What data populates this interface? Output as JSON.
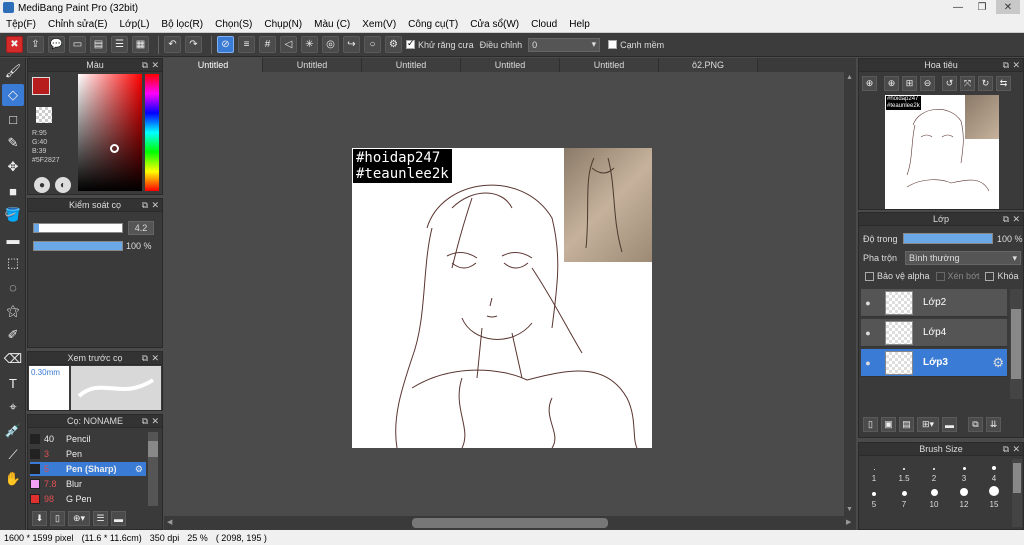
{
  "window": {
    "title": "MediBang Paint Pro (32bit)",
    "min_label": "—",
    "max_label": "❐",
    "close_label": "✕"
  },
  "menu": [
    "Tệp(F)",
    "Chỉnh sửa(E)",
    "Lớp(L)",
    "Bộ lọc(R)",
    "Chọn(S)",
    "Chụp(N)",
    "Màu (C)",
    "Xem(V)",
    "Công cụ(T)",
    "Cửa sổ(W)",
    "Cloud",
    "Help"
  ],
  "toolbar": {
    "antialias_label": "Khử răng cưa",
    "correction_label": "Điều chỉnh",
    "correction_value": "0",
    "snap_label": "Cạnh mềm"
  },
  "tabs": [
    "Untitled",
    "Untitled",
    "Untitled",
    "Untitled",
    "Untitled",
    "ô2.PNG"
  ],
  "color_panel": {
    "title": "Màu",
    "r": "R:95",
    "g": "G:40",
    "b": "B:39",
    "hex": "#5F2827",
    "fg_color": "#b81d1d"
  },
  "brush_ctrl": {
    "title": "Kiểm soát cọ",
    "size": "4.2",
    "opacity": "100 %"
  },
  "preview": {
    "title": "Xem trước cọ",
    "size": "0.30mm"
  },
  "brushes": {
    "title": "Cọ: NONAME",
    "items": [
      {
        "size": "40",
        "name": "Pencil",
        "color": "#222222"
      },
      {
        "size": "3",
        "name": "Pen",
        "color": "#222222"
      },
      {
        "size": "5",
        "name": "Pen (Sharp)",
        "color": "#222222"
      },
      {
        "size": "7.8",
        "name": "Blur",
        "color": "#f2a0f2"
      },
      {
        "size": "98",
        "name": "G Pen",
        "color": "#e03030"
      }
    ]
  },
  "navigator": {
    "title": "Hoa tiêu"
  },
  "layers": {
    "title": "Lớp",
    "opacity_label": "Độ trong",
    "opacity_value": "100 %",
    "blend_label": "Pha trộn",
    "blend_value": "Bình thường",
    "protect_alpha": "Bảo vệ alpha",
    "clipping": "Xén bớt",
    "lock": "Khóa",
    "items": [
      {
        "name": "Lớp2"
      },
      {
        "name": "Lớp4"
      },
      {
        "name": "Lớp3"
      }
    ]
  },
  "brush_size": {
    "title": "Brush Size",
    "sizes": [
      "1",
      "1.5",
      "2",
      "3",
      "4",
      "5",
      "7",
      "10",
      "12",
      "15"
    ]
  },
  "canvas": {
    "hashtag1": "#hoidap247",
    "hashtag2": "#teaunlee2k",
    "nav_hashtag1": "#hoidap247",
    "nav_hashtag2": "#teaunlee2k"
  },
  "status": {
    "dims": "1600 * 1599 pixel",
    "size": "(11.6 * 11.6cm)",
    "dpi": "350 dpi",
    "zoom": "25 %",
    "coords": "( 2098, 195 )"
  }
}
